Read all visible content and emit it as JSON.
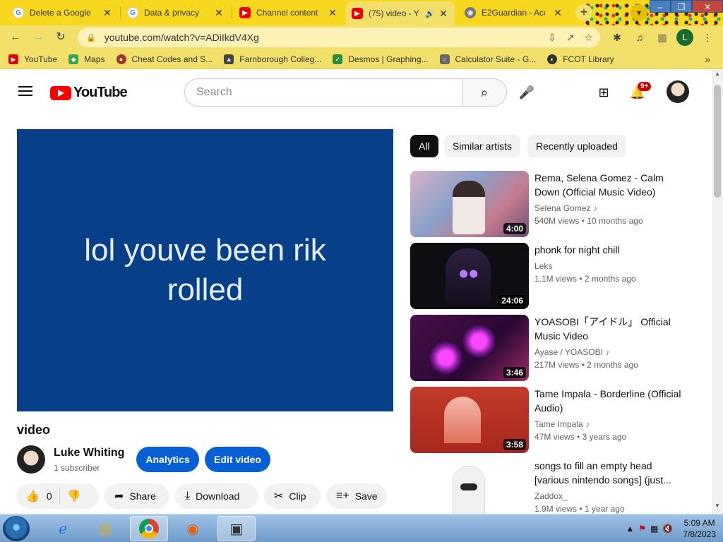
{
  "browser": {
    "tabs": [
      {
        "label": "Delete a Google s",
        "icon": "google-icon"
      },
      {
        "label": "Data & privacy",
        "icon": "google-icon"
      },
      {
        "label": "Channel content -",
        "icon": "youtube-icon"
      },
      {
        "label": "(75) video - Y",
        "icon": "youtube-icon",
        "active": true
      },
      {
        "label": "E2Guardian - Acc",
        "icon": "e2guardian-icon"
      }
    ],
    "url": "youtube.com/watch?v=ADiIkdV4Xg",
    "profile_initial": "L",
    "bookmarks": [
      {
        "label": "YouTube",
        "color": "#e00000"
      },
      {
        "label": "Maps",
        "color": "#34a853"
      },
      {
        "label": "Cheat Codes and S...",
        "color": "#a3322a"
      },
      {
        "label": "Farnborough Colleg...",
        "color": "#444444"
      },
      {
        "label": "Desmos | Graphing...",
        "color": "#2d8c3c"
      },
      {
        "label": "Calculator Suite - G...",
        "color": "#666666"
      },
      {
        "label": "FCOT Library",
        "color": "#333333"
      }
    ]
  },
  "youtube": {
    "logo_text": "YouTube",
    "search_placeholder": "Search",
    "notification_count": "9+",
    "player_text": "lol youve been rik rolled",
    "video_title": "video",
    "channel_name": "Luke Whiting",
    "subscribers": "1 subscriber",
    "analytics_label": "Analytics",
    "edit_label": "Edit video",
    "like_count": "0",
    "share_label": "Share",
    "download_label": "Download",
    "clip_label": "Clip",
    "save_label": "Save",
    "chips": [
      "All",
      "Similar artists",
      "Recently uploaded"
    ],
    "recommendations": [
      {
        "title": "Rema, Selena Gomez - Calm Down (Official Music Video)",
        "channel": "Selena Gomez",
        "music": true,
        "views": "540M views",
        "age": "10 months ago",
        "duration": "4:00"
      },
      {
        "title": "phonk for night chill",
        "channel": "Leks",
        "music": false,
        "views": "1.1M views",
        "age": "2 months ago",
        "duration": "24:06"
      },
      {
        "title": "YOASOBI「アイドル」 Official Music Video",
        "channel": "Ayase / YOASOBI",
        "music": true,
        "views": "217M views",
        "age": "2 months ago",
        "duration": "3:46"
      },
      {
        "title": "Tame Impala - Borderline (Official Audio)",
        "channel": "Tame Impala",
        "music": true,
        "views": "47M views",
        "age": "3 years ago",
        "duration": "3:58"
      },
      {
        "title": "songs to fill an empty head [various nintendo songs] (just...",
        "channel": "Zaddox_",
        "music": false,
        "views": "1.9M views",
        "age": "1 year ago",
        "duration": ""
      }
    ]
  },
  "taskbar": {
    "time": "5:09 AM",
    "date": "7/8/2023"
  }
}
